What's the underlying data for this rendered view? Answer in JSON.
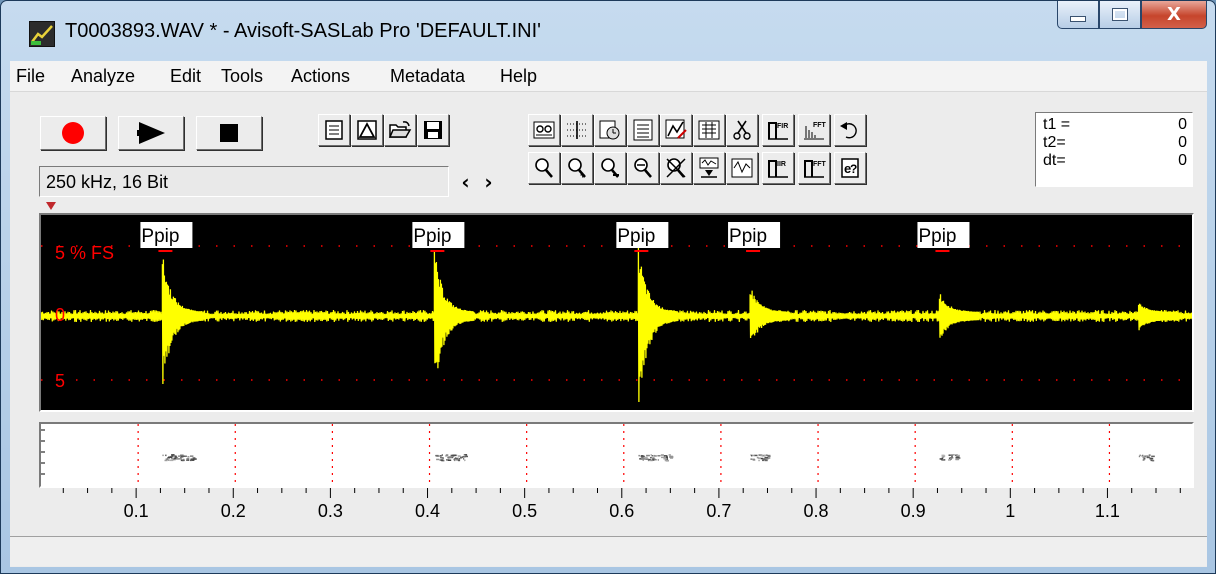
{
  "window": {
    "title": "T0003893.WAV * - Avisoft-SASLab Pro  'DEFAULT.INI'",
    "icon": "app-logo-icon",
    "controls": {
      "minimize_icon": "minimize-icon",
      "maximize_icon": "maximize-icon",
      "close_icon": "close-icon",
      "close_glyph": "X"
    }
  },
  "menu": [
    "File",
    "Analyze",
    "Edit",
    "Tools",
    "Actions",
    "Metadata",
    "Help"
  ],
  "transport": [
    {
      "name": "record-button",
      "icon": "record-icon"
    },
    {
      "name": "play-button",
      "icon": "play-icon"
    },
    {
      "name": "stop-button",
      "icon": "stop-icon"
    }
  ],
  "file_tools": [
    "file-info-icon",
    "envelope-icon",
    "open-folder-icon",
    "save-icon"
  ],
  "toolbar_row1": [
    "metadata-icon",
    "grid-cursor-icon",
    "clock-icon",
    "text-list-icon",
    "waveform-edit-icon",
    "spectrogram-icon",
    "cut-icon",
    "fir-filter-icon",
    "fft-icon",
    "undo-icon"
  ],
  "toolbar_row1_text": {
    "fir": "FIR",
    "fft": "FFT"
  },
  "toolbar_row2": [
    "zoom-in-icon",
    "zoom-in-plus-icon",
    "zoom-out-icon",
    "zoom-custom-icon",
    "zoom-reset-icon",
    "insert-icon",
    "spectrum-view-icon",
    "iir-filter-icon",
    "fft-filter-icon",
    "sync-icon"
  ],
  "toolbar_row2_text": {
    "iir": "IIR",
    "fft": "FFT"
  },
  "format_info": "250 kHz, 16 Bit",
  "nav_arrows": {
    "left": "‹",
    "right": "›"
  },
  "readout": [
    {
      "label": "t1 =",
      "value": "0"
    },
    {
      "label": "t2=",
      "value": "0"
    },
    {
      "label": "dt=",
      "value": "0"
    }
  ],
  "colors": {
    "waveform": "#ffff00",
    "annotation_marker": "#ff0000",
    "scale_text": "#ff0000",
    "panel_bg": "#000000"
  },
  "waveform": {
    "scale_top": "5 % FS",
    "scale_mid": "0",
    "scale_bottom": "5",
    "labels": [
      {
        "text": "Ppip",
        "time": 0.125
      },
      {
        "text": "Ppip",
        "time": 0.405
      },
      {
        "text": "Ppip",
        "time": 0.615
      },
      {
        "text": "Ppip",
        "time": 0.73
      },
      {
        "text": "Ppip",
        "time": 0.925
      }
    ],
    "events": [
      {
        "time": 0.125,
        "amp_up": 0.85,
        "amp_down": 0.95
      },
      {
        "time": 0.405,
        "amp_up": 0.9,
        "amp_down": 1.0
      },
      {
        "time": 0.615,
        "amp_up": 0.95,
        "amp_down": 1.3
      },
      {
        "time": 0.73,
        "amp_up": 0.4,
        "amp_down": 0.4
      },
      {
        "time": 0.925,
        "amp_up": 0.3,
        "amp_down": 0.3
      },
      {
        "time": 1.13,
        "amp_up": 0.15,
        "amp_down": 0.15
      }
    ],
    "time_range": [
      0,
      1.185
    ]
  },
  "time_axis": {
    "labels": [
      "0.1",
      "0.2",
      "0.3",
      "0.4",
      "0.5",
      "0.6",
      "0.7",
      "0.8",
      "0.9",
      "1",
      "1.1"
    ],
    "values": [
      0.1,
      0.2,
      0.3,
      0.4,
      0.5,
      0.6,
      0.7,
      0.8,
      0.9,
      1.0,
      1.1
    ],
    "minor_step": 0.025
  },
  "status_text": ""
}
